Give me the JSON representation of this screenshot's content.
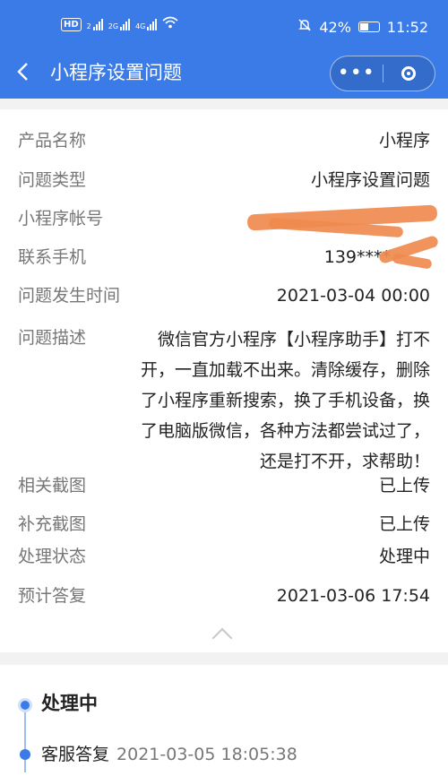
{
  "status_bar": {
    "hd": "HD",
    "sim1": "2",
    "net1": "2G",
    "net2": "4G",
    "battery": "42%",
    "time": "11:52"
  },
  "nav": {
    "back_icon": "chevron-left-icon",
    "title": "小程序设置问题",
    "more_icon": "more-dots-icon",
    "close_icon": "close-circle-icon"
  },
  "details": {
    "product_name": {
      "label": "产品名称",
      "value": "小程序"
    },
    "issue_type": {
      "label": "问题类型",
      "value": "小程序设置问题"
    },
    "account": {
      "label": "小程序帐号",
      "value": ""
    },
    "phone": {
      "label": "联系手机",
      "value": "139****"
    },
    "occur_time": {
      "label": "问题发生时间",
      "value": "2021-03-04 00:00"
    },
    "description": {
      "label": "问题描述",
      "value": "微信官方小程序【小程序助手】打不开，一直加载不出来。清除缓存，删除了小程序重新搜索，换了手机设备，换了电脑版微信，各种方法都尝试过了，还是打不开，求帮助！"
    },
    "screenshots": {
      "label": "相关截图",
      "value": "已上传"
    },
    "extra_screenshots": {
      "label": "补充截图",
      "value": "已上传"
    },
    "status": {
      "label": "处理状态",
      "value": "处理中"
    },
    "expected_reply": {
      "label": "预计答复",
      "value": "2021-03-06 17:54"
    }
  },
  "timeline": {
    "current": "处理中",
    "entries": [
      {
        "label": "客服答复",
        "time": "2021-03-05 18:05:38"
      }
    ]
  },
  "colors": {
    "primary": "#3b7be8",
    "mask": "#f08a4e"
  }
}
